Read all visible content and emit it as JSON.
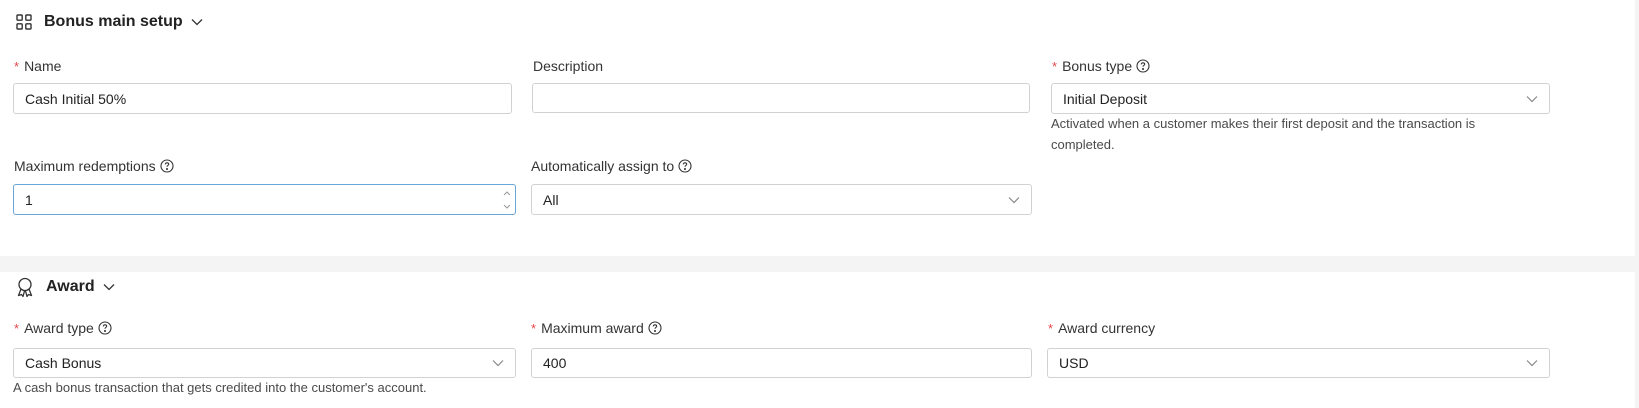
{
  "main_setup": {
    "title": "Bonus main setup",
    "name": {
      "label": "Name",
      "value": "Cash Initial 50%"
    },
    "description": {
      "label": "Description",
      "value": ""
    },
    "bonus_type": {
      "label": "Bonus type",
      "value": "Initial Deposit",
      "hint": "Activated when a customer makes their first deposit and the transaction is completed."
    },
    "max_redemptions": {
      "label": "Maximum redemptions",
      "value": "1"
    },
    "auto_assign": {
      "label": "Automatically assign to",
      "value": "All"
    }
  },
  "award": {
    "title": "Award",
    "award_type": {
      "label": "Award type",
      "value": "Cash Bonus",
      "hint": "A cash bonus transaction that gets credited into the customer's account."
    },
    "max_award": {
      "label": "Maximum award",
      "value": "400"
    },
    "award_currency": {
      "label": "Award currency",
      "value": "USD"
    }
  },
  "colors": {
    "required": "#e5484d",
    "focus_border": "#6aa6d8",
    "border": "#d2d2d2",
    "background": "#f4f4f4"
  },
  "icons": [
    "grid-icon",
    "award-ribbon-icon",
    "chevron-down-icon",
    "help-circle-icon",
    "spin-up-icon",
    "spin-down-icon"
  ]
}
